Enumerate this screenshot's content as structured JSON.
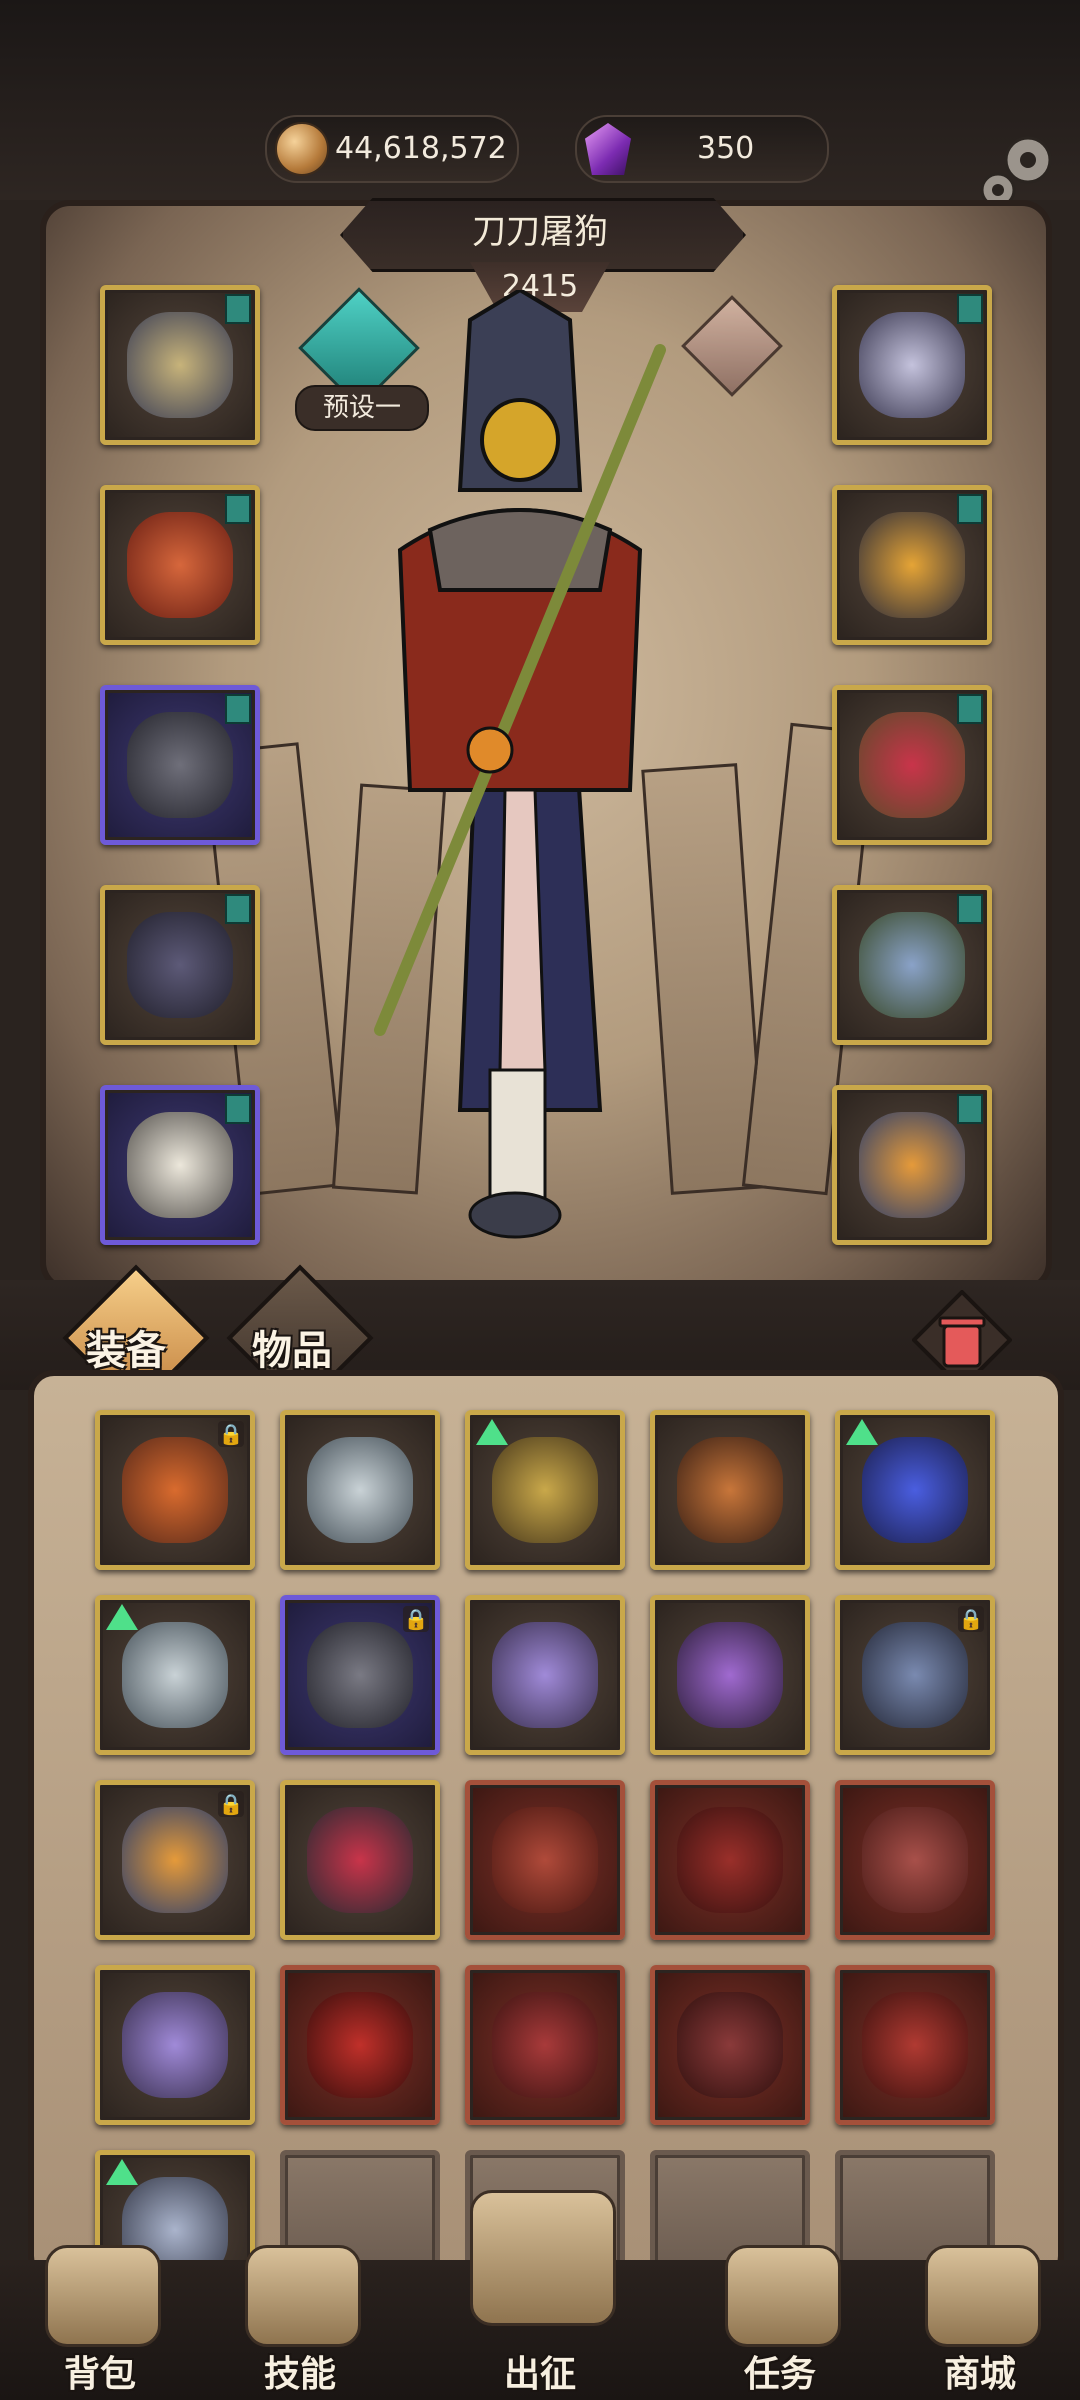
{
  "currency": {
    "coins": "44,618,572",
    "gems": "350",
    "coin_icon": "coin-icon",
    "gem_icon": "crystal-gem-icon"
  },
  "hero": {
    "name": "刀刀屠狗",
    "power": "2415",
    "preset_label": "预设一"
  },
  "equipment_left": [
    {
      "name": "hood-helmet",
      "rarity": "gold",
      "tag": true
    },
    {
      "name": "flame-cloak",
      "rarity": "gold",
      "tag": true
    },
    {
      "name": "shadow-gauntlets",
      "rarity": "purple",
      "tag": true
    },
    {
      "name": "dark-leg-armor",
      "rarity": "gold",
      "tag": true
    },
    {
      "name": "white-boots",
      "rarity": "purple",
      "tag": true
    }
  ],
  "equipment_right": [
    {
      "name": "skull-pendant",
      "rarity": "gold",
      "tag": true
    },
    {
      "name": "amber-bracer",
      "rarity": "gold",
      "tag": true
    },
    {
      "name": "ruby-ring",
      "rarity": "gold",
      "tag": true
    },
    {
      "name": "feather-staff",
      "rarity": "gold",
      "tag": true
    },
    {
      "name": "orb-spellbook",
      "rarity": "gold",
      "tag": true
    }
  ],
  "inventory": {
    "tabs": [
      "装备",
      "物品"
    ],
    "active_tab": "装备",
    "slots": [
      {
        "name": "fire-book",
        "rarity": "gold",
        "lock": true,
        "up": false
      },
      {
        "name": "silver-amulet",
        "rarity": "gold",
        "lock": false,
        "up": false
      },
      {
        "name": "lion-amulet",
        "rarity": "gold",
        "lock": false,
        "up": true
      },
      {
        "name": "thorn-amulet",
        "rarity": "gold",
        "lock": false,
        "up": false
      },
      {
        "name": "sapphire-heart-amulet",
        "rarity": "gold",
        "lock": false,
        "up": true
      },
      {
        "name": "silver-amulet",
        "rarity": "gold",
        "lock": false,
        "up": true
      },
      {
        "name": "shadow-gauntlets",
        "rarity": "purple",
        "lock": true,
        "up": false
      },
      {
        "name": "crystal-staff",
        "rarity": "gold",
        "lock": false,
        "up": false
      },
      {
        "name": "spiral-wand",
        "rarity": "gold",
        "lock": false,
        "up": false
      },
      {
        "name": "wolf-armor",
        "rarity": "gold",
        "lock": true,
        "up": false
      },
      {
        "name": "orb-spellbook",
        "rarity": "gold",
        "lock": true,
        "up": false
      },
      {
        "name": "ruby-bracer",
        "rarity": "gold",
        "lock": false,
        "up": false
      },
      {
        "name": "crimson-boots",
        "rarity": "red",
        "lock": false,
        "up": false
      },
      {
        "name": "crimson-chest",
        "rarity": "red",
        "lock": false,
        "up": false
      },
      {
        "name": "crimson-armor",
        "rarity": "red",
        "lock": false,
        "up": false
      },
      {
        "name": "crystal-staff",
        "rarity": "gold",
        "lock": false,
        "up": false
      },
      {
        "name": "demon-mask",
        "rarity": "red",
        "lock": false,
        "up": false
      },
      {
        "name": "spiked-blade",
        "rarity": "red",
        "lock": false,
        "up": false
      },
      {
        "name": "crimson-scepter",
        "rarity": "red",
        "lock": false,
        "up": false
      },
      {
        "name": "crimson-gauntlet",
        "rarity": "red",
        "lock": false,
        "up": false
      },
      {
        "name": "silver-staff",
        "rarity": "gold",
        "lock": false,
        "up": true
      },
      {
        "name": "empty",
        "rarity": "empty",
        "lock": false,
        "up": false
      },
      {
        "name": "empty",
        "rarity": "empty",
        "lock": false,
        "up": false
      },
      {
        "name": "empty",
        "rarity": "empty",
        "lock": false,
        "up": false
      },
      {
        "name": "empty",
        "rarity": "empty",
        "lock": false,
        "up": false
      }
    ]
  },
  "nav": [
    {
      "label": "背包",
      "icon": "backpack-icon"
    },
    {
      "label": "技能",
      "icon": "skill-card-icon"
    },
    {
      "label": "出征",
      "icon": "sword-map-icon"
    },
    {
      "label": "任务",
      "icon": "horn-icon"
    },
    {
      "label": "商城",
      "icon": "shop-icon"
    }
  ],
  "colors": {
    "gold_frame": "#c9a84a",
    "purple_frame": "#6e5ad8",
    "red_frame": "#a4503a",
    "tag_teal": "#2f8a7d",
    "upgrade_green": "#4fe08a"
  }
}
